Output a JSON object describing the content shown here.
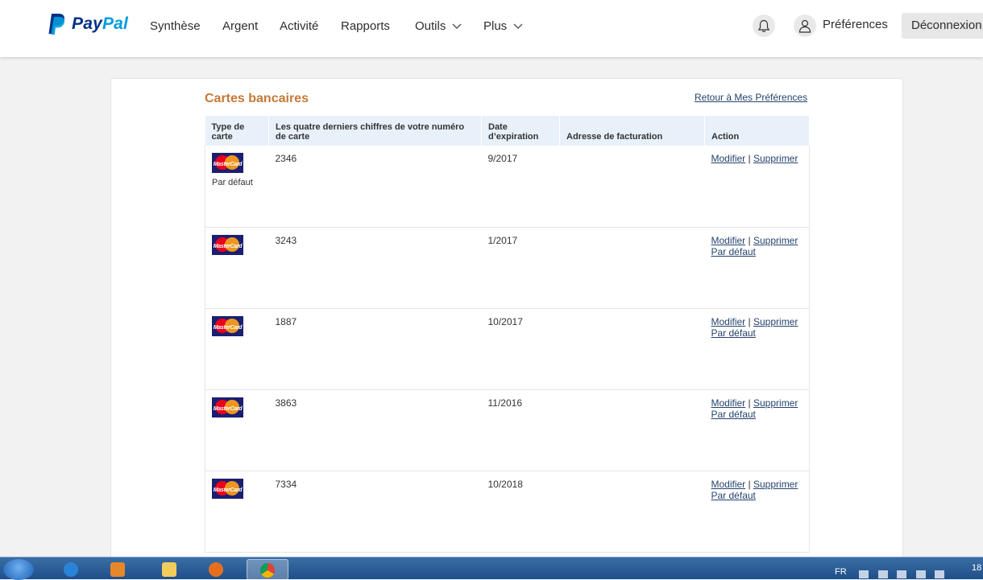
{
  "brand": {
    "pay": "Pay",
    "pal": "Pal"
  },
  "nav": {
    "items": [
      {
        "label": "Synthèse",
        "dropdown": false
      },
      {
        "label": "Argent",
        "dropdown": false
      },
      {
        "label": "Activité",
        "dropdown": false
      },
      {
        "label": "Rapports",
        "dropdown": false
      },
      {
        "label": "Outils",
        "dropdown": true
      },
      {
        "label": "Plus",
        "dropdown": true
      }
    ]
  },
  "header": {
    "preferences": "Préférences",
    "logout": "Déconnexion"
  },
  "page": {
    "title": "Cartes bancaires",
    "back_link": "Retour à Mes Préférences"
  },
  "table": {
    "headers": [
      "Type de carte",
      "Les quatre derniers chiffres de votre numéro de carte",
      "Date d’expiration",
      "Adresse de facturation",
      "Action"
    ],
    "rows": [
      {
        "brand": "MasterCard",
        "default_label": "Par défaut",
        "last4": "2346",
        "expiry": "9/2017",
        "address": "",
        "modify": "Modifier",
        "sep": "|",
        "delete": "Supprimer",
        "set_default": ""
      },
      {
        "brand": "MasterCard",
        "default_label": "",
        "last4": "3243",
        "expiry": "1/2017",
        "address": "",
        "modify": "Modifier",
        "sep": "|",
        "delete": "Supprimer",
        "set_default": "Par défaut"
      },
      {
        "brand": "MasterCard",
        "default_label": "",
        "last4": "1887",
        "expiry": "10/2017",
        "address": "",
        "modify": "Modifier",
        "sep": "|",
        "delete": "Supprimer",
        "set_default": "Par défaut"
      },
      {
        "brand": "MasterCard",
        "default_label": "",
        "last4": "3863",
        "expiry": "11/2016",
        "address": "",
        "modify": "Modifier",
        "sep": "|",
        "delete": "Supprimer",
        "set_default": "Par défaut"
      },
      {
        "brand": "MasterCard",
        "default_label": "",
        "last4": "7334",
        "expiry": "10/2018",
        "address": "",
        "modify": "Modifier",
        "sep": "|",
        "delete": "Supprimer",
        "set_default": "Par défaut"
      }
    ]
  },
  "taskbar": {
    "lang": "FR",
    "clock": "18"
  },
  "colors": {
    "brand_dark": "#003087",
    "brand_light": "#009cde",
    "title": "#c47937",
    "link": "#25436c",
    "header_bg": "#e8f0fa"
  }
}
